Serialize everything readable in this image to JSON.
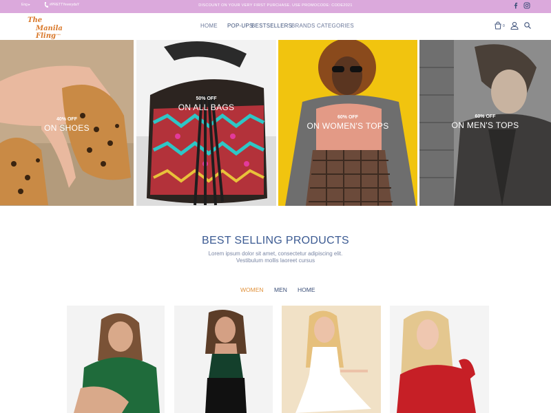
{
  "topbar": {
    "language": "Eng ▸",
    "phone": "#PRETTYeverydaY",
    "promo": "DISCOUNT ON YOUR VERY FIRST PURCHASE. USE PROMOCODE: CODE2021"
  },
  "brand": {
    "logo_line1": "The",
    "logo_line2": "Manila Fling",
    "logo_tagline": "fashion & more"
  },
  "nav": {
    "items": [
      {
        "label": "HOME",
        "active": false
      },
      {
        "label": "POP-UPS",
        "active": true
      },
      {
        "label": "BESTSELLERS",
        "active": true
      },
      {
        "label": "BRANDS",
        "active": false
      },
      {
        "label": "CATEGORIES",
        "active": false
      }
    ]
  },
  "header_icons": {
    "cart": "cart-icon",
    "cart_count": "0",
    "account": "user-icon",
    "search": "search-icon"
  },
  "banners": [
    {
      "discount": "40% OFF",
      "label": "ON SHOES"
    },
    {
      "discount": "50% OFF",
      "label": "ON ALL BAGS"
    },
    {
      "discount": "60% OFF",
      "label": "ON WOMEN'S TOPS"
    },
    {
      "discount": "60% OFF",
      "label": "ON MEN'S TOPS"
    }
  ],
  "best_selling": {
    "title": "BEST SELLING PRODUCTS",
    "subtitle_line1": "Lorem ipsum dolor sit amet, consectetur adipiscing elit.",
    "subtitle_line2": "Vestibulum mollis laoreet cursus",
    "tabs": [
      {
        "label": "WOMEN",
        "active": true
      },
      {
        "label": "MEN",
        "active": false
      },
      {
        "label": "HOME",
        "active": false
      }
    ]
  },
  "colors": {
    "topbar": "#dba9dc",
    "brand_orange": "#d9792b",
    "nav_text": "#6a7799",
    "heading_blue": "#3b5a92",
    "tab_active": "#e0913a",
    "banner_yellow": "#f1c40f"
  }
}
